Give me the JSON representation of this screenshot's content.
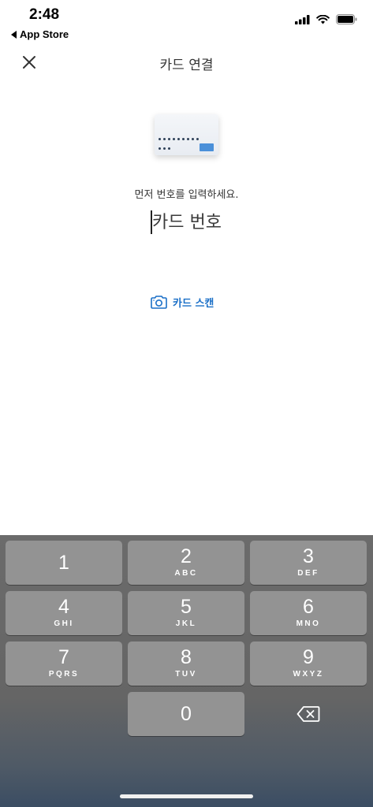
{
  "status_bar": {
    "time": "2:48",
    "back_app": "App Store",
    "icons": [
      "cellular-signal-icon",
      "wifi-icon",
      "battery-icon"
    ]
  },
  "header": {
    "title": "카드 연결",
    "close_icon": "close-icon"
  },
  "main": {
    "prompt": "먼저 번호를 입력하세요.",
    "card_number_input": {
      "value": "",
      "placeholder": "카드 번호"
    },
    "scan_button": {
      "label": "카드 스캔",
      "icon": "camera-icon"
    }
  },
  "keypad": {
    "keys": [
      {
        "digit": "1",
        "letters": ""
      },
      {
        "digit": "2",
        "letters": "ABC"
      },
      {
        "digit": "3",
        "letters": "DEF"
      },
      {
        "digit": "4",
        "letters": "GHI"
      },
      {
        "digit": "5",
        "letters": "JKL"
      },
      {
        "digit": "6",
        "letters": "MNO"
      },
      {
        "digit": "7",
        "letters": "PQRS"
      },
      {
        "digit": "8",
        "letters": "TUV"
      },
      {
        "digit": "9",
        "letters": "WXYZ"
      },
      {
        "digit": "0",
        "letters": ""
      }
    ],
    "backspace_icon": "backspace-icon"
  },
  "colors": {
    "accent": "#1a6fc7",
    "key_background": "#939393",
    "keyboard_background": "#6b6b6b"
  }
}
